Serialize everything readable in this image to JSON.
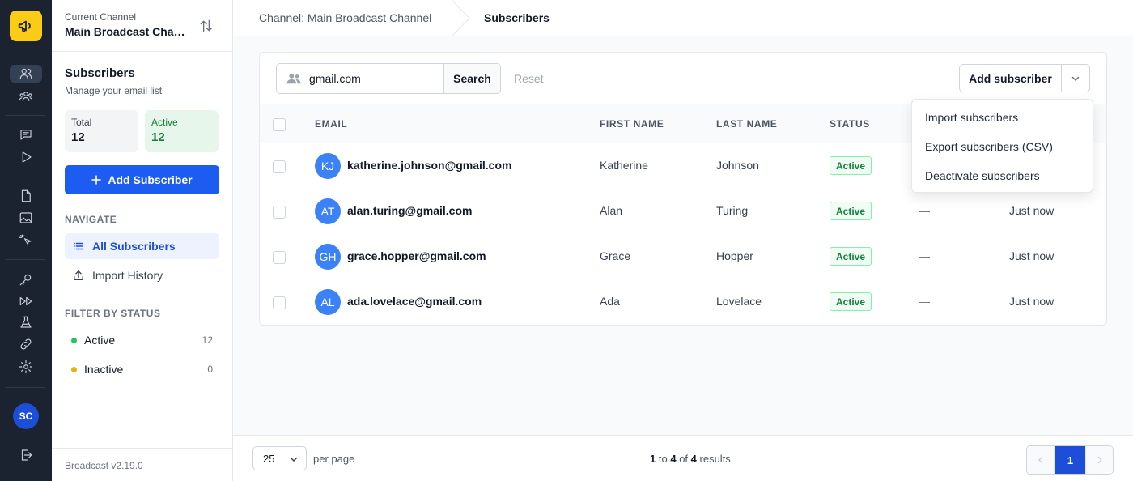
{
  "channel": {
    "caption": "Current Channel",
    "name": "Main Broadcast Channel"
  },
  "subscribers_panel": {
    "title": "Subscribers",
    "subtitle": "Manage your email list",
    "stats": {
      "total_label": "Total",
      "total_value": "12",
      "active_label": "Active",
      "active_value": "12"
    },
    "add_button_label": "Add Subscriber",
    "navigate_caption": "NAVIGATE",
    "nav_items": [
      {
        "label": "All Subscribers",
        "icon": "list-icon"
      },
      {
        "label": "Import History",
        "icon": "upload-icon"
      }
    ],
    "filter_caption": "FILTER BY STATUS",
    "filters": [
      {
        "label": "Active",
        "count": "12",
        "color": "#22c55e"
      },
      {
        "label": "Inactive",
        "count": "0",
        "color": "#eab308"
      }
    ],
    "version": "Broadcast v2.19.0"
  },
  "rail": {
    "avatar_initials": "SC",
    "logo_color": "#facc15"
  },
  "breadcrumbs": {
    "parent": "Channel: Main Broadcast Channel",
    "current": "Subscribers"
  },
  "toolbar": {
    "search_value": "gmail.com",
    "search_button": "Search",
    "reset_label": "Reset",
    "add_subscriber_label": "Add subscriber"
  },
  "table": {
    "columns": [
      "EMAIL",
      "FIRST NAME",
      "LAST NAME",
      "STATUS"
    ],
    "rows": [
      {
        "initials": "KJ",
        "email": "katherine.johnson@gmail.com",
        "first": "Katherine",
        "last": "Johnson",
        "status": "Active",
        "dash": "—",
        "time": ""
      },
      {
        "initials": "AT",
        "email": "alan.turing@gmail.com",
        "first": "Alan",
        "last": "Turing",
        "status": "Active",
        "dash": "—",
        "time": "Just now"
      },
      {
        "initials": "GH",
        "email": "grace.hopper@gmail.com",
        "first": "Grace",
        "last": "Hopper",
        "status": "Active",
        "dash": "—",
        "time": "Just now"
      },
      {
        "initials": "AL",
        "email": "ada.lovelace@gmail.com",
        "first": "Ada",
        "last": "Lovelace",
        "status": "Active",
        "dash": "—",
        "time": "Just now"
      }
    ]
  },
  "dropdown": {
    "items": [
      "Import subscribers",
      "Export subscribers (CSV)",
      "Deactivate subscribers"
    ]
  },
  "footer": {
    "per_page_value": "25",
    "per_page_label": "per page",
    "results": {
      "from": "1",
      "to_word": "to",
      "to": "4",
      "of_word": "of",
      "total": "4",
      "suffix": "results"
    },
    "current_page": "1"
  },
  "colors": {
    "primary": "#1d5cf0",
    "rail_bg": "#1b2330",
    "active_green": "#15803d",
    "avatar_blue": "#3b82f6"
  }
}
